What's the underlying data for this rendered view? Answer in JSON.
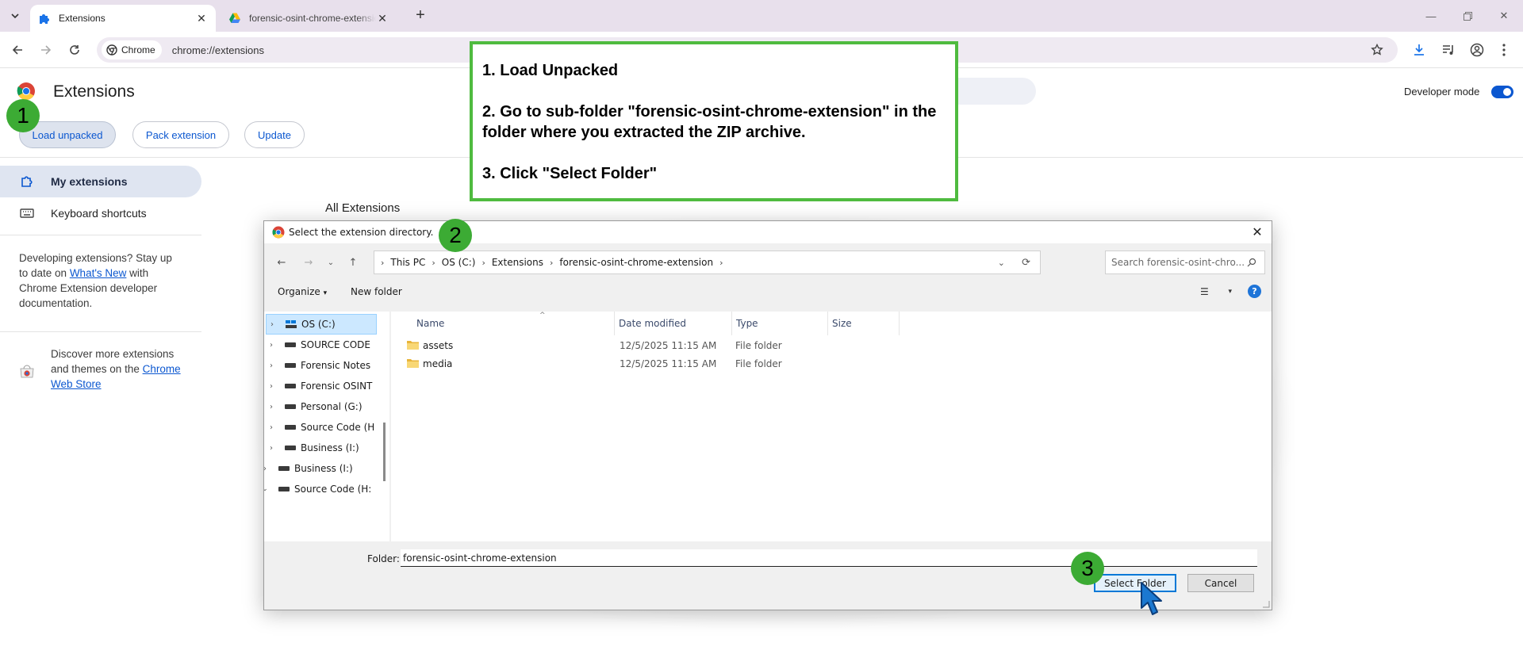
{
  "browser": {
    "tabs": [
      {
        "title": "Extensions",
        "icon": "puzzle-icon",
        "active": true
      },
      {
        "title": "forensic-osint-chrome-extension",
        "icon": "google-drive-icon",
        "active": false
      }
    ],
    "omnibox": {
      "chip_label": "Chrome",
      "url": "chrome://extensions"
    }
  },
  "extensions_page": {
    "title": "Extensions",
    "developer_mode_label": "Developer mode",
    "developer_mode_on": true,
    "buttons": {
      "load_unpacked": "Load unpacked",
      "pack_extension": "Pack extension",
      "update": "Update"
    },
    "sidebar": {
      "items": [
        {
          "label": "My extensions",
          "icon": "extension-icon",
          "selected": true
        },
        {
          "label": "Keyboard shortcuts",
          "icon": "keyboard-icon",
          "selected": false
        }
      ],
      "dev_text_before": "Developing extensions? Stay up to date on ",
      "dev_link": "What's New",
      "dev_text_after": " with Chrome Extension developer documentation.",
      "discover_text": "Discover more extensions and themes on the ",
      "discover_link": "Chrome Web Store"
    },
    "section_title": "All Extensions"
  },
  "annotation": {
    "step1": "1. Load Unpacked",
    "step2": "2. Go to sub-folder \"forensic-osint-chrome-extension\" in the folder where you extracted the ZIP archive.",
    "step3": "3. Click \"Select Folder\"",
    "markers": [
      "1",
      "2",
      "3"
    ],
    "border_color": "#4fbb3f",
    "marker_color": "#3cab34"
  },
  "dialog": {
    "title": "Select the extension directory.",
    "breadcrumb": [
      "This PC",
      "OS (C:)",
      "Extensions",
      "forensic-osint-chrome-extension"
    ],
    "search_placeholder": "Search forensic-osint-chro...",
    "toolbar": {
      "organize": "Organize",
      "new_folder": "New folder"
    },
    "nav_tree": [
      {
        "label": "OS (C:)",
        "selected": true
      },
      {
        "label": "SOURCE CODE",
        "selected": false
      },
      {
        "label": "Forensic Notes",
        "selected": false
      },
      {
        "label": "Forensic OSINT",
        "selected": false
      },
      {
        "label": "Personal (G:)",
        "selected": false
      },
      {
        "label": "Source Code (H",
        "selected": false
      },
      {
        "label": "Business (I:)",
        "selected": false
      },
      {
        "label": "Business (I:)",
        "selected": false
      },
      {
        "label": "Source Code (H:",
        "selected": false
      }
    ],
    "columns": [
      "Name",
      "Date modified",
      "Type",
      "Size"
    ],
    "files": [
      {
        "name": "assets",
        "date": "12/5/2025 11:15 AM",
        "type": "File folder",
        "size": ""
      },
      {
        "name": "media",
        "date": "12/5/2025 11:15 AM",
        "type": "File folder",
        "size": ""
      }
    ],
    "folder_label": "Folder:",
    "folder_value": "forensic-osint-chrome-extension",
    "select_button": "Select Folder",
    "cancel_button": "Cancel"
  }
}
